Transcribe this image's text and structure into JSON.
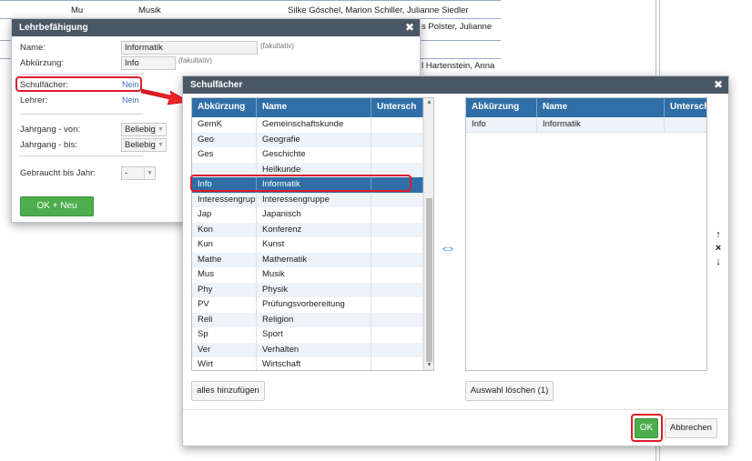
{
  "background": {
    "rows": [
      {
        "abbr": "Mu",
        "name": "Musik",
        "teachers": "Silke Göschel, Marion Schiller, Julianne Siedler"
      },
      {
        "abbr": "",
        "name": "",
        "teachers": "s Polster, Julianne"
      },
      {
        "abbr": "",
        "name": "",
        "teachers": "l Hartenstein, Anna"
      }
    ]
  },
  "lehrbefaehigung": {
    "title": "Lehrbefähigung",
    "name_label": "Name:",
    "name_value": "Informatik",
    "name_hint": "(fakultativ)",
    "abbr_label": "Abkürzung:",
    "abbr_value": "Info",
    "abbr_hint": "(fakultativ)",
    "subjects_label": "Schulfächer:",
    "subjects_value": "Nein",
    "teachers_label": "Lehrer:",
    "teachers_value": "Nein",
    "grade_from_label": "Jahrgang - von:",
    "grade_from_value": "Beliebig",
    "grade_to_label": "Jahrgang - bis:",
    "grade_to_value": "Beliebig",
    "used_until_label": "Gebraucht bis Jahr:",
    "used_until_value": "-",
    "ok_new_label": "OK + Neu"
  },
  "schulfaecher": {
    "title": "Schulfächer",
    "columns": [
      "Abkürzung",
      "Name",
      "Untersch"
    ],
    "available": [
      {
        "abbr": "GemK",
        "name": "Gemeinschaftskunde"
      },
      {
        "abbr": "Geo",
        "name": "Geografie"
      },
      {
        "abbr": "Ges",
        "name": "Geschichte"
      },
      {
        "abbr": "",
        "name": "Heilkunde"
      },
      {
        "abbr": "Info",
        "name": "Informatik"
      },
      {
        "abbr": "Interessengrupp",
        "name": "Interessengruppe"
      },
      {
        "abbr": "Jap",
        "name": "Japanisch"
      },
      {
        "abbr": "Kon",
        "name": "Konferenz"
      },
      {
        "abbr": "Kun",
        "name": "Kunst"
      },
      {
        "abbr": "Mathe",
        "name": "Mathematik"
      },
      {
        "abbr": "Mus",
        "name": "Musik"
      },
      {
        "abbr": "Phy",
        "name": "Physik"
      },
      {
        "abbr": "PV",
        "name": "Prüfungsvorbereitung"
      },
      {
        "abbr": "Reli",
        "name": "Religion"
      },
      {
        "abbr": "Sp",
        "name": "Sport"
      },
      {
        "abbr": "Ver",
        "name": "Verhalten"
      },
      {
        "abbr": "Wirt",
        "name": "Wirtschaft"
      }
    ],
    "selected_index": 4,
    "chosen": [
      {
        "abbr": "Info",
        "name": "Informatik"
      }
    ],
    "add_all_label": "alles hinzufügen",
    "clear_selection_label": "Auswahl löschen (1)",
    "ok_label": "OK",
    "cancel_label": "Abbrechen",
    "move_up_glyph": "↑",
    "remove_glyph": "×",
    "move_down_glyph": "↓",
    "transfer_glyph": "⇔"
  },
  "colors": {
    "header_dark": "#4a5866",
    "grid_header": "#2f6ea6",
    "selection": "#2f6ea6",
    "accent_green": "#4cae4c",
    "highlight_red": "#e01b2a",
    "link": "#3a78b8"
  }
}
